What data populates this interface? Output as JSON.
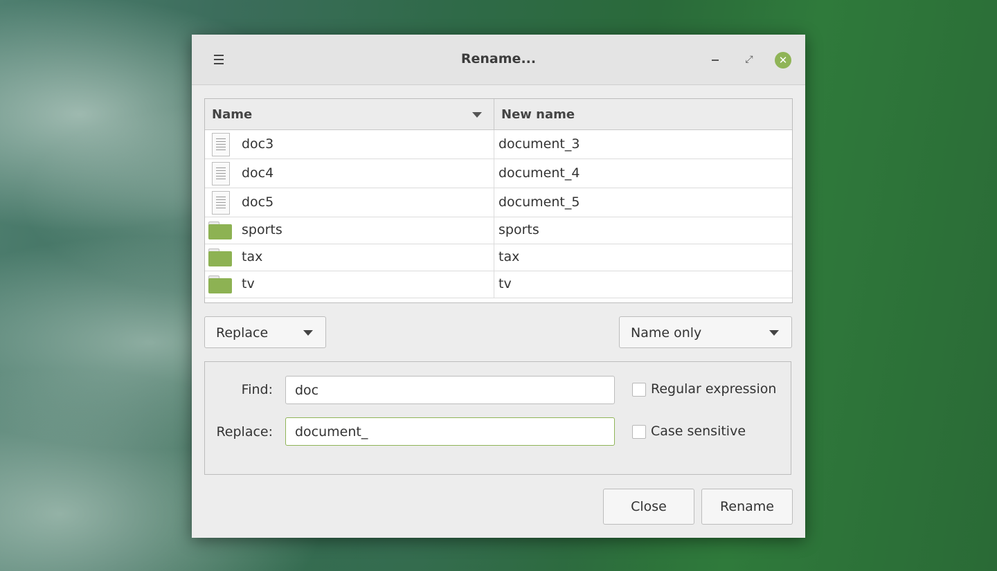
{
  "window": {
    "title": "Rename..."
  },
  "icons": {
    "menu": "hamburger-menu-icon",
    "minimize": "minimize-icon",
    "restore": "restore-icon",
    "close": "close-icon",
    "document": "document-icon",
    "folder": "folder-icon"
  },
  "colors": {
    "accent": "#8fb457",
    "folder": "#8db253"
  },
  "list": {
    "columns": {
      "name": "Name",
      "new_name": "New name"
    },
    "rows": [
      {
        "type": "document",
        "name": "doc3",
        "new_name": "document_3"
      },
      {
        "type": "document",
        "name": "doc4",
        "new_name": "document_4"
      },
      {
        "type": "document",
        "name": "doc5",
        "new_name": "document_5"
      },
      {
        "type": "folder",
        "name": "sports",
        "new_name": "sports"
      },
      {
        "type": "folder",
        "name": "tax",
        "new_name": "tax"
      },
      {
        "type": "folder",
        "name": "tv",
        "new_name": "tv"
      }
    ]
  },
  "mode": {
    "selected": "Replace"
  },
  "scope": {
    "selected": "Name only"
  },
  "find": {
    "label": "Find:",
    "value": "doc"
  },
  "replace": {
    "label": "Replace:",
    "value": "document_"
  },
  "options": {
    "regex_label": "Regular expression",
    "regex_checked": false,
    "case_label": "Case sensitive",
    "case_checked": false
  },
  "buttons": {
    "close": "Close",
    "rename": "Rename"
  }
}
